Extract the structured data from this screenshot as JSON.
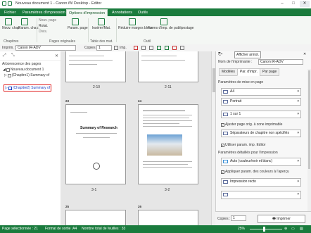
{
  "window": {
    "title": "Nouveau document 1 - Canon iW Desktop - Editor",
    "controls": [
      "–",
      "□",
      "✕"
    ]
  },
  "ribbon_tabs": [
    {
      "label": "Fichier",
      "active": false
    },
    {
      "label": "Paramètres d'impression",
      "active": false
    },
    {
      "label": "Options d'impression",
      "active": true
    },
    {
      "label": "Annotations",
      "active": false
    },
    {
      "label": "Outils",
      "active": false
    }
  ],
  "ribbon": {
    "nouveau_chap": "Nouv. chap.",
    "param_chap": "Param. chap.",
    "nouv_page": "Nouv. page",
    "rotat": "Rotat.",
    "divis": "Divis.",
    "param_page": "Param. page",
    "inserer_mat": "Insérer/Mat.",
    "reduire": "Réduire marges blocs",
    "forms": "Forms d'imp. de publipostage",
    "group_chapitres": "Chapitres",
    "group_pages": "Pages originales",
    "group_table": "Table des mat.",
    "group_outil": "Outil"
  },
  "toolbar": {
    "imprim_label": "Imprim. :",
    "imprim_value": "Canon iR-ADV",
    "copies_label": "Copies :",
    "copies_value": "1",
    "imp_label": "Imp.",
    "afficher_annot": "Afficher annot."
  },
  "left_pane": {
    "heading": "Arborescence des pages",
    "nodes": [
      {
        "label": "Nouveau document 1"
      },
      {
        "label": "(Chapitre1) Summary of"
      },
      {
        "label": "(Chapitre2) Summary of"
      }
    ]
  },
  "pages": {
    "labels": [
      "2-10",
      "2-11",
      "3-1",
      "3-2"
    ],
    "page_numbers": [
      "23",
      "24",
      "25",
      "26"
    ],
    "summary_title": "Summary of Research"
  },
  "right_pane": {
    "printer_label": "Nom de l'imprimante :",
    "printer_value": "Canon iR-ADV",
    "tabs": [
      "Modèles",
      "Par. d'impr.",
      "Par page"
    ],
    "mise_en_page_label": "Paramètres de mise en page",
    "paper": "A4",
    "orientation": "Portrait",
    "layout": "1 sur 1",
    "ajuster_label": "Ajuster page orig. à zone imprimable",
    "separateurs": "Séparateurs de chapitre non spécifiés",
    "utiliser_label": "Utiliser param. imp. Editor",
    "details_label": "Paramètres détaillés pour l'impression",
    "couleur": "Auto (couleur/noir et blanc)",
    "appliquer_label": "Appliquer param. des couleurs à l'aperçu",
    "recto": "Impression recto",
    "copies_label": "Copies :",
    "copies_value": "1",
    "imprimer": "Imprimer"
  },
  "status": {
    "page_sel": "Page sélectionnée : 21",
    "format": "Format de sortie :A4",
    "total": "Nombre total de feuilles : 33",
    "zoom": "25%"
  },
  "colors": {
    "accent": "#1a7b3d",
    "selection": "#e02020",
    "link": "#1a3cc0"
  }
}
